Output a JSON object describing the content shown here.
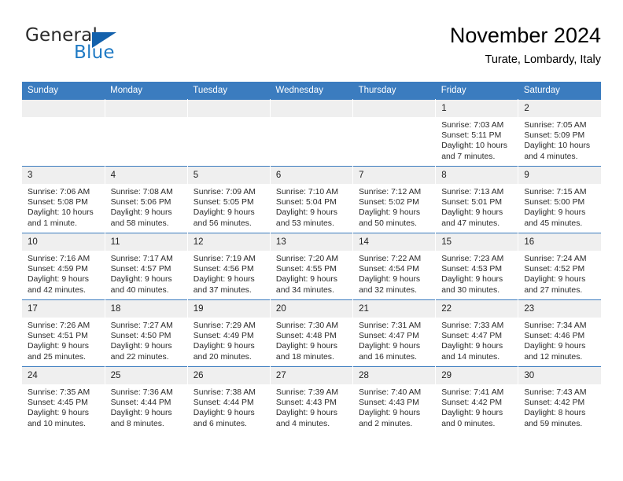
{
  "brand": {
    "name_part1": "General",
    "name_part2": "Blue",
    "accent_color": "#1f7ac4",
    "triangle_color": "#1361ac",
    "triangle_icon": "triangle-icon"
  },
  "header": {
    "title": "November 2024",
    "subtitle": "Turate, Lombardy, Italy"
  },
  "theme": {
    "header_blue": "#3b7cbf",
    "daynum_bg": "#efefef",
    "text": "#000000"
  },
  "weekdays": [
    "Sunday",
    "Monday",
    "Tuesday",
    "Wednesday",
    "Thursday",
    "Friday",
    "Saturday"
  ],
  "weeks": [
    [
      {
        "day": "",
        "empty": true,
        "sunrise": "",
        "sunset": "",
        "daylight1": "",
        "daylight2": ""
      },
      {
        "day": "",
        "empty": true,
        "sunrise": "",
        "sunset": "",
        "daylight1": "",
        "daylight2": ""
      },
      {
        "day": "",
        "empty": true,
        "sunrise": "",
        "sunset": "",
        "daylight1": "",
        "daylight2": ""
      },
      {
        "day": "",
        "empty": true,
        "sunrise": "",
        "sunset": "",
        "daylight1": "",
        "daylight2": ""
      },
      {
        "day": "",
        "empty": true,
        "sunrise": "",
        "sunset": "",
        "daylight1": "",
        "daylight2": ""
      },
      {
        "day": "1",
        "empty": false,
        "sunrise": "Sunrise: 7:03 AM",
        "sunset": "Sunset: 5:11 PM",
        "daylight1": "Daylight: 10 hours",
        "daylight2": "and 7 minutes."
      },
      {
        "day": "2",
        "empty": false,
        "sunrise": "Sunrise: 7:05 AM",
        "sunset": "Sunset: 5:09 PM",
        "daylight1": "Daylight: 10 hours",
        "daylight2": "and 4 minutes."
      }
    ],
    [
      {
        "day": "3",
        "empty": false,
        "sunrise": "Sunrise: 7:06 AM",
        "sunset": "Sunset: 5:08 PM",
        "daylight1": "Daylight: 10 hours",
        "daylight2": "and 1 minute."
      },
      {
        "day": "4",
        "empty": false,
        "sunrise": "Sunrise: 7:08 AM",
        "sunset": "Sunset: 5:06 PM",
        "daylight1": "Daylight: 9 hours",
        "daylight2": "and 58 minutes."
      },
      {
        "day": "5",
        "empty": false,
        "sunrise": "Sunrise: 7:09 AM",
        "sunset": "Sunset: 5:05 PM",
        "daylight1": "Daylight: 9 hours",
        "daylight2": "and 56 minutes."
      },
      {
        "day": "6",
        "empty": false,
        "sunrise": "Sunrise: 7:10 AM",
        "sunset": "Sunset: 5:04 PM",
        "daylight1": "Daylight: 9 hours",
        "daylight2": "and 53 minutes."
      },
      {
        "day": "7",
        "empty": false,
        "sunrise": "Sunrise: 7:12 AM",
        "sunset": "Sunset: 5:02 PM",
        "daylight1": "Daylight: 9 hours",
        "daylight2": "and 50 minutes."
      },
      {
        "day": "8",
        "empty": false,
        "sunrise": "Sunrise: 7:13 AM",
        "sunset": "Sunset: 5:01 PM",
        "daylight1": "Daylight: 9 hours",
        "daylight2": "and 47 minutes."
      },
      {
        "day": "9",
        "empty": false,
        "sunrise": "Sunrise: 7:15 AM",
        "sunset": "Sunset: 5:00 PM",
        "daylight1": "Daylight: 9 hours",
        "daylight2": "and 45 minutes."
      }
    ],
    [
      {
        "day": "10",
        "empty": false,
        "sunrise": "Sunrise: 7:16 AM",
        "sunset": "Sunset: 4:59 PM",
        "daylight1": "Daylight: 9 hours",
        "daylight2": "and 42 minutes."
      },
      {
        "day": "11",
        "empty": false,
        "sunrise": "Sunrise: 7:17 AM",
        "sunset": "Sunset: 4:57 PM",
        "daylight1": "Daylight: 9 hours",
        "daylight2": "and 40 minutes."
      },
      {
        "day": "12",
        "empty": false,
        "sunrise": "Sunrise: 7:19 AM",
        "sunset": "Sunset: 4:56 PM",
        "daylight1": "Daylight: 9 hours",
        "daylight2": "and 37 minutes."
      },
      {
        "day": "13",
        "empty": false,
        "sunrise": "Sunrise: 7:20 AM",
        "sunset": "Sunset: 4:55 PM",
        "daylight1": "Daylight: 9 hours",
        "daylight2": "and 34 minutes."
      },
      {
        "day": "14",
        "empty": false,
        "sunrise": "Sunrise: 7:22 AM",
        "sunset": "Sunset: 4:54 PM",
        "daylight1": "Daylight: 9 hours",
        "daylight2": "and 32 minutes."
      },
      {
        "day": "15",
        "empty": false,
        "sunrise": "Sunrise: 7:23 AM",
        "sunset": "Sunset: 4:53 PM",
        "daylight1": "Daylight: 9 hours",
        "daylight2": "and 30 minutes."
      },
      {
        "day": "16",
        "empty": false,
        "sunrise": "Sunrise: 7:24 AM",
        "sunset": "Sunset: 4:52 PM",
        "daylight1": "Daylight: 9 hours",
        "daylight2": "and 27 minutes."
      }
    ],
    [
      {
        "day": "17",
        "empty": false,
        "sunrise": "Sunrise: 7:26 AM",
        "sunset": "Sunset: 4:51 PM",
        "daylight1": "Daylight: 9 hours",
        "daylight2": "and 25 minutes."
      },
      {
        "day": "18",
        "empty": false,
        "sunrise": "Sunrise: 7:27 AM",
        "sunset": "Sunset: 4:50 PM",
        "daylight1": "Daylight: 9 hours",
        "daylight2": "and 22 minutes."
      },
      {
        "day": "19",
        "empty": false,
        "sunrise": "Sunrise: 7:29 AM",
        "sunset": "Sunset: 4:49 PM",
        "daylight1": "Daylight: 9 hours",
        "daylight2": "and 20 minutes."
      },
      {
        "day": "20",
        "empty": false,
        "sunrise": "Sunrise: 7:30 AM",
        "sunset": "Sunset: 4:48 PM",
        "daylight1": "Daylight: 9 hours",
        "daylight2": "and 18 minutes."
      },
      {
        "day": "21",
        "empty": false,
        "sunrise": "Sunrise: 7:31 AM",
        "sunset": "Sunset: 4:47 PM",
        "daylight1": "Daylight: 9 hours",
        "daylight2": "and 16 minutes."
      },
      {
        "day": "22",
        "empty": false,
        "sunrise": "Sunrise: 7:33 AM",
        "sunset": "Sunset: 4:47 PM",
        "daylight1": "Daylight: 9 hours",
        "daylight2": "and 14 minutes."
      },
      {
        "day": "23",
        "empty": false,
        "sunrise": "Sunrise: 7:34 AM",
        "sunset": "Sunset: 4:46 PM",
        "daylight1": "Daylight: 9 hours",
        "daylight2": "and 12 minutes."
      }
    ],
    [
      {
        "day": "24",
        "empty": false,
        "sunrise": "Sunrise: 7:35 AM",
        "sunset": "Sunset: 4:45 PM",
        "daylight1": "Daylight: 9 hours",
        "daylight2": "and 10 minutes."
      },
      {
        "day": "25",
        "empty": false,
        "sunrise": "Sunrise: 7:36 AM",
        "sunset": "Sunset: 4:44 PM",
        "daylight1": "Daylight: 9 hours",
        "daylight2": "and 8 minutes."
      },
      {
        "day": "26",
        "empty": false,
        "sunrise": "Sunrise: 7:38 AM",
        "sunset": "Sunset: 4:44 PM",
        "daylight1": "Daylight: 9 hours",
        "daylight2": "and 6 minutes."
      },
      {
        "day": "27",
        "empty": false,
        "sunrise": "Sunrise: 7:39 AM",
        "sunset": "Sunset: 4:43 PM",
        "daylight1": "Daylight: 9 hours",
        "daylight2": "and 4 minutes."
      },
      {
        "day": "28",
        "empty": false,
        "sunrise": "Sunrise: 7:40 AM",
        "sunset": "Sunset: 4:43 PM",
        "daylight1": "Daylight: 9 hours",
        "daylight2": "and 2 minutes."
      },
      {
        "day": "29",
        "empty": false,
        "sunrise": "Sunrise: 7:41 AM",
        "sunset": "Sunset: 4:42 PM",
        "daylight1": "Daylight: 9 hours",
        "daylight2": "and 0 minutes."
      },
      {
        "day": "30",
        "empty": false,
        "sunrise": "Sunrise: 7:43 AM",
        "sunset": "Sunset: 4:42 PM",
        "daylight1": "Daylight: 8 hours",
        "daylight2": "and 59 minutes."
      }
    ]
  ]
}
